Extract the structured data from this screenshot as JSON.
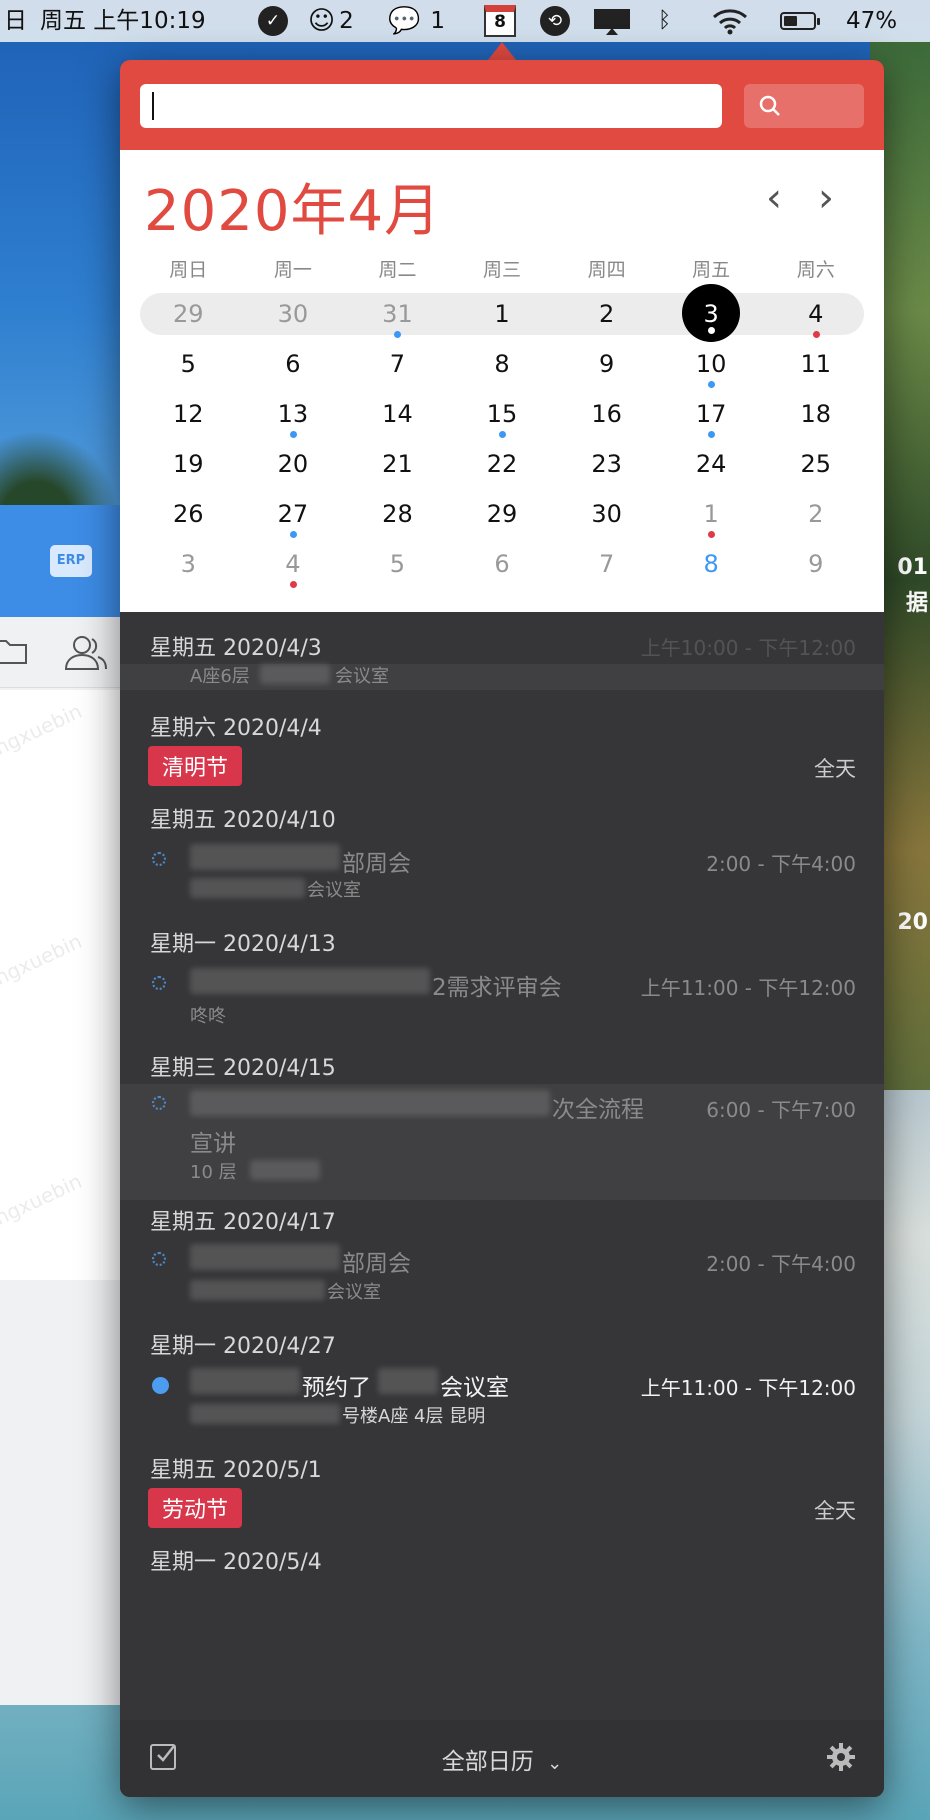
{
  "menubar": {
    "day": "日",
    "clock": "周五 上午10:19",
    "notif_count": "2",
    "wechat_count": "1",
    "calendar_day": "8",
    "battery_percent": "47%",
    "battery_level": 0.47
  },
  "search": {
    "placeholder": ""
  },
  "calendar": {
    "title": "2020年4月",
    "weekdays": [
      "周日",
      "周一",
      "周二",
      "周三",
      "周四",
      "周五",
      "周六"
    ],
    "weeks": [
      [
        {
          "d": "29",
          "other": true
        },
        {
          "d": "30",
          "other": true
        },
        {
          "d": "31",
          "other": true,
          "dot": "blue"
        },
        {
          "d": "1"
        },
        {
          "d": "2"
        },
        {
          "d": "3",
          "today": true,
          "dot": "white"
        },
        {
          "d": "4",
          "dot": "red"
        }
      ],
      [
        {
          "d": "5"
        },
        {
          "d": "6"
        },
        {
          "d": "7"
        },
        {
          "d": "8"
        },
        {
          "d": "9"
        },
        {
          "d": "10",
          "dot": "blue"
        },
        {
          "d": "11"
        }
      ],
      [
        {
          "d": "12"
        },
        {
          "d": "13",
          "dot": "blue"
        },
        {
          "d": "14"
        },
        {
          "d": "15",
          "dot": "blue"
        },
        {
          "d": "16"
        },
        {
          "d": "17",
          "dot": "blue"
        },
        {
          "d": "18"
        }
      ],
      [
        {
          "d": "19"
        },
        {
          "d": "20"
        },
        {
          "d": "21"
        },
        {
          "d": "22"
        },
        {
          "d": "23"
        },
        {
          "d": "24"
        },
        {
          "d": "25"
        }
      ],
      [
        {
          "d": "26"
        },
        {
          "d": "27",
          "dot": "blue"
        },
        {
          "d": "28"
        },
        {
          "d": "29"
        },
        {
          "d": "30"
        },
        {
          "d": "1",
          "other": true,
          "dot": "red"
        },
        {
          "d": "2",
          "other": true
        }
      ],
      [
        {
          "d": "3",
          "other": true
        },
        {
          "d": "4",
          "other": true,
          "dot": "red"
        },
        {
          "d": "5",
          "other": true
        },
        {
          "d": "6",
          "other": true
        },
        {
          "d": "7",
          "other": true
        },
        {
          "d": "8",
          "blue": true
        },
        {
          "d": "9",
          "other": true
        }
      ]
    ]
  },
  "events": {
    "d1": {
      "header": "星期五 2020/4/3",
      "sub": "A座6层",
      "sub2": "会议室",
      "time": "上午10:00 - 下午12:00"
    },
    "d2": {
      "header": "星期六 2020/4/4",
      "holiday": "清明节",
      "allday": "全天"
    },
    "d3": {
      "header": "星期五 2020/4/10",
      "title": "部周会",
      "sub": "会议室",
      "time": "2:00 - 下午4:00"
    },
    "d4": {
      "header": "星期一 2020/4/13",
      "title": "2需求评审会",
      "sub": "咚咚",
      "time": "上午11:00 - 下午12:00"
    },
    "d5": {
      "header": "星期三 2020/4/15",
      "title": "次全流程",
      "title2": "宣讲",
      "sub": "10 层",
      "time": "6:00 - 下午7:00"
    },
    "d6": {
      "header": "星期五 2020/4/17",
      "title": "部周会",
      "sub": "会议室",
      "time": "2:00 - 下午4:00"
    },
    "d7": {
      "header": "星期一 2020/4/27",
      "title": "预约了",
      "title2": "会议室",
      "sub": "号楼A座 4层 昆明",
      "time": "上午11:00 - 下午12:00"
    },
    "d8": {
      "header": "星期五 2020/5/1",
      "holiday": "劳动节",
      "allday": "全天"
    },
    "d9": {
      "header": "星期一 2020/5/4"
    }
  },
  "footer": {
    "all_calendars": "全部日历"
  },
  "left_app": {
    "logo": "ERP"
  },
  "desktop": {
    "strip1": "01",
    "strip2": "据",
    "strip3": "20"
  },
  "colors": {
    "accent": "#e04a40",
    "event_blue": "#4c9cf0",
    "holiday_red": "#d8364a"
  }
}
